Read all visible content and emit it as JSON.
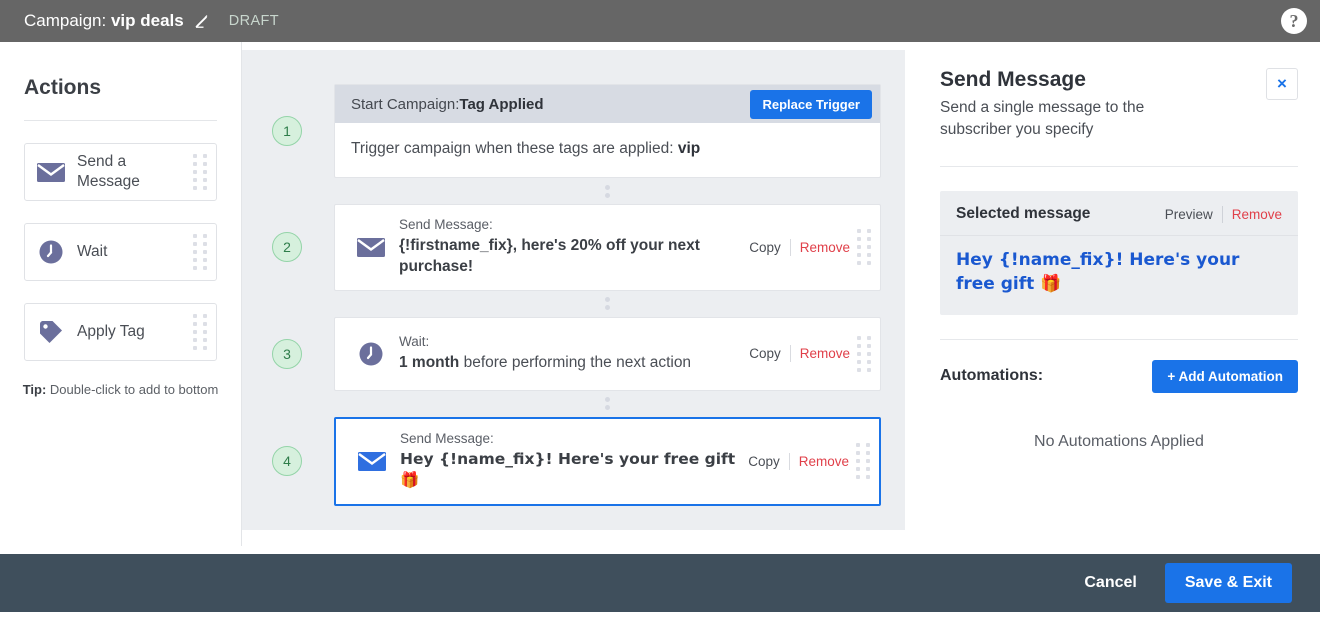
{
  "colors": {
    "topbar_bg": "#666666",
    "accent_blue": "#1a73e8",
    "remove_red": "#e0404a",
    "footer_bg": "#3f4f5c",
    "canvas_bg": "#eceef1",
    "badge_green_bg": "#d6f0dd",
    "badge_green_border": "#94d4a8",
    "badge_green_text": "#2e7d4a",
    "icon_muted_purple": "#6b6f9c",
    "icon_blue": "#2f6fe0",
    "link_blue": "#1a58d0"
  },
  "topbar": {
    "label_prefix": "Campaign:",
    "campaign_name": "vip deals",
    "edit_icon": "pencil-icon",
    "status": "DRAFT",
    "help_icon": "question-mark-icon",
    "help_glyph": "?"
  },
  "sidebar": {
    "title": "Actions",
    "items": [
      {
        "label": "Send a Message",
        "icon": "envelope-icon"
      },
      {
        "label": "Wait",
        "icon": "clock-icon"
      },
      {
        "label": "Apply Tag",
        "icon": "tag-icon"
      }
    ],
    "tip_bold": "Tip:",
    "tip_text": " Double-click to add to bottom"
  },
  "flow": {
    "trigger": {
      "number": "1",
      "head_prefix": "Start Campaign:",
      "head_bold": "Tag Applied",
      "replace_button": "Replace Trigger",
      "body_text": "Trigger campaign when these tags are applied: ",
      "body_bold": "vip"
    },
    "steps": [
      {
        "number": "2",
        "icon": "envelope-icon",
        "icon_style": "muted",
        "kind": "Send Message:",
        "desc": "{!firstname_fix}, here's 20% off your next purchase!",
        "desc_bold": true,
        "copy_label": "Copy",
        "remove_label": "Remove",
        "selected": false
      },
      {
        "number": "3",
        "icon": "clock-icon",
        "icon_style": "muted",
        "kind": "Wait:",
        "desc_bold_part": "1 month",
        "desc_rest": " before performing the next action",
        "copy_label": "Copy",
        "remove_label": "Remove",
        "selected": false
      },
      {
        "number": "4",
        "icon": "envelope-icon",
        "icon_style": "blue",
        "kind": "Send Message:",
        "desc": "Hey {!name_fix}! Here's your free gift 🎁",
        "desc_bold": true,
        "copy_label": "Copy",
        "remove_label": "Remove",
        "selected": true
      }
    ],
    "scrollbar": {
      "up_arrow_icon": "triangle-up-icon",
      "down_arrow_icon": "triangle-down-icon",
      "thumb_icon": "scrollbar-thumb"
    }
  },
  "panel": {
    "title": "Send Message",
    "subtitle": "Send a single message to the subscriber you specify",
    "close_icon": "close-icon",
    "close_glyph": "×",
    "selected_message": {
      "header": "Selected message",
      "preview_label": "Preview",
      "remove_label": "Remove",
      "message_text": "Hey {!name_fix}! Here's your free gift 🎁"
    },
    "automations": {
      "label": "Automations:",
      "add_button": "+ Add Automation",
      "empty_text": "No Automations Applied"
    }
  },
  "footer": {
    "cancel_label": "Cancel",
    "save_label": "Save & Exit"
  }
}
